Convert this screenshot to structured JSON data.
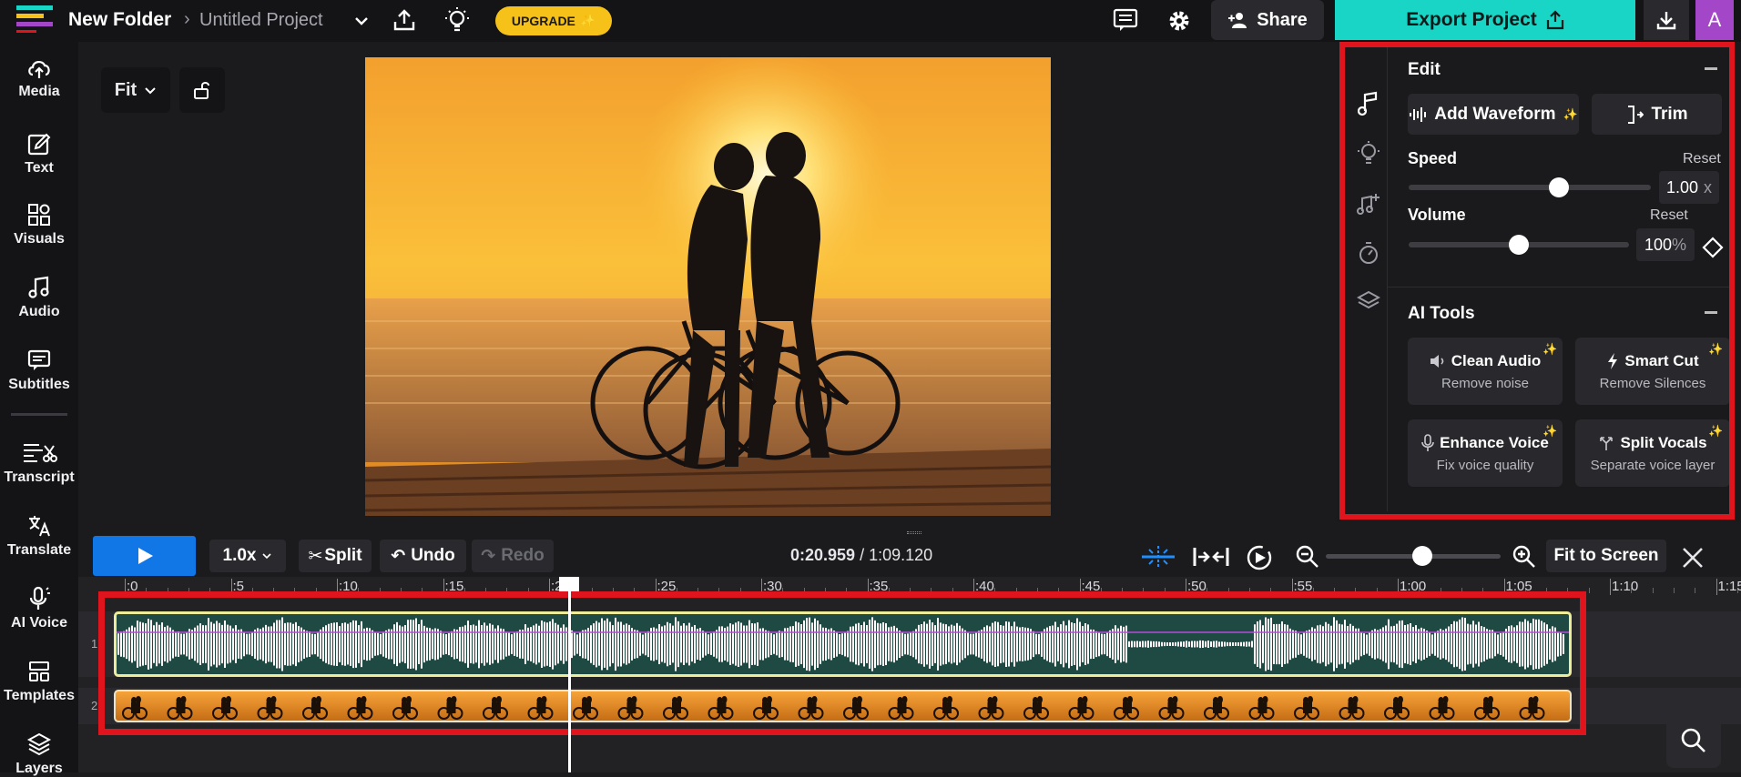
{
  "header": {
    "folder": "New Folder",
    "project": "Untitled Project",
    "upgrade_label": "UPGRADE",
    "share_label": "Share",
    "export_label": "Export Project",
    "avatar_letter": "A"
  },
  "sidebar": {
    "items": [
      {
        "label": "Media",
        "icon": "upload-cloud-icon"
      },
      {
        "label": "Text",
        "icon": "edit-icon"
      },
      {
        "label": "Visuals",
        "icon": "shapes-icon"
      },
      {
        "label": "Audio",
        "icon": "music-note-icon"
      },
      {
        "label": "Subtitles",
        "icon": "subtitles-icon"
      },
      {
        "label": "Transcript",
        "icon": "transcript-icon"
      },
      {
        "label": "Translate",
        "icon": "translate-icon"
      },
      {
        "label": "AI Voice",
        "icon": "microphone-icon"
      },
      {
        "label": "Templates",
        "icon": "templates-icon"
      },
      {
        "label": "Layers",
        "icon": "layers-icon"
      }
    ]
  },
  "preview": {
    "fit_label": "Fit"
  },
  "panel": {
    "edit_title": "Edit",
    "add_waveform": "Add Waveform",
    "trim": "Trim",
    "speed_label": "Speed",
    "speed_reset": "Reset",
    "speed_value": "1.00",
    "speed_unit": "x",
    "speed_level": 0.62,
    "volume_label": "Volume",
    "volume_reset": "Reset",
    "volume_value": "100",
    "volume_unit": "%",
    "volume_level": 0.5,
    "ai_title": "AI Tools",
    "ai_tools": [
      {
        "title": "Clean Audio",
        "sub": "Remove noise",
        "icon": "speaker-icon"
      },
      {
        "title": "Smart Cut",
        "sub": "Remove Silences",
        "icon": "lightning-icon"
      },
      {
        "title": "Enhance Voice",
        "sub": "Fix voice quality",
        "icon": "microphone-icon"
      },
      {
        "title": "Split Vocals",
        "sub": "Separate voice layer",
        "icon": "split-icon"
      }
    ]
  },
  "toolbar": {
    "speed": "1.0x",
    "split": "Split",
    "undo": "Undo",
    "redo": "Redo",
    "current_time": "0:20.959",
    "total_time": "1:09.120",
    "zoom_level": 0.55,
    "fit_to_screen": "Fit to Screen"
  },
  "timeline": {
    "ruler": [
      ":0",
      ":5",
      ":10",
      ":15",
      ":20",
      ":25",
      ":30",
      ":35",
      ":40",
      ":45",
      ":50",
      ":55",
      "1:00",
      "1:05",
      "1:10",
      "1:15"
    ],
    "track_numbers": [
      "1",
      "2"
    ],
    "playhead_seconds": 20.959
  },
  "colors": {
    "accent": "#19d5c5",
    "play": "#1277e6",
    "highlight": "#e0141c",
    "upgrade": "#f6c21a",
    "avatar": "#a346c7"
  }
}
